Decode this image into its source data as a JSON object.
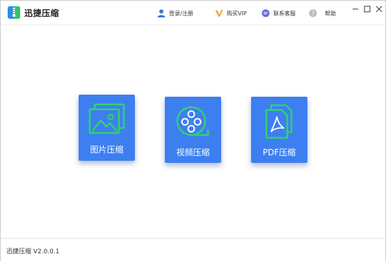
{
  "app": {
    "title": "迅捷压缩",
    "version_text": "迅捷压缩 V2.0.0.1"
  },
  "header": {
    "nav": [
      {
        "label": "登录/注册",
        "icon": "user-icon"
      },
      {
        "label": "购买VIP",
        "icon": "vip-icon"
      },
      {
        "label": "联系客服",
        "icon": "chat-icon"
      },
      {
        "label": "帮助",
        "icon": "help-icon"
      }
    ],
    "window_controls": [
      "minimize-icon",
      "maximize-icon",
      "close-icon"
    ]
  },
  "tiles": [
    {
      "label": "图片压缩",
      "icon": "image-icon"
    },
    {
      "label": "视频压缩",
      "icon": "film-reel-icon"
    },
    {
      "label": "PDF压缩",
      "icon": "pdf-file-icon"
    }
  ],
  "colors": {
    "tile_blue": "#3d7ff0",
    "icon_green": "#2fd36b",
    "user_icon": "#3a7bd5",
    "vip_icon": "#f2a93b",
    "chat_icon": "#6a6cd9",
    "help_icon": "#bcbcbc"
  }
}
